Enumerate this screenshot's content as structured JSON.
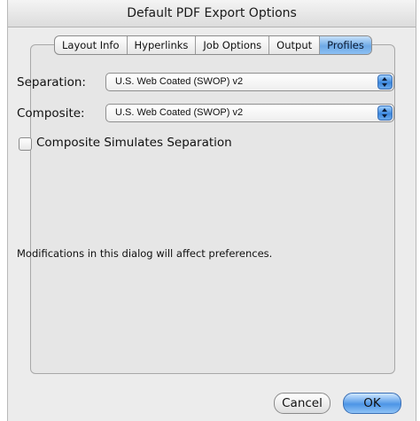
{
  "window": {
    "title": "Default PDF Export Options"
  },
  "tabs": [
    {
      "label": "Layout Info",
      "selected": false
    },
    {
      "label": "Hyperlinks",
      "selected": false
    },
    {
      "label": "Job Options",
      "selected": false
    },
    {
      "label": "Output",
      "selected": false
    },
    {
      "label": "Profiles",
      "selected": true
    }
  ],
  "fields": {
    "separation": {
      "label": "Separation:",
      "value": "U.S. Web Coated (SWOP) v2"
    },
    "composite": {
      "label": "Composite:",
      "value": "U.S. Web Coated (SWOP) v2"
    }
  },
  "checkbox": {
    "label": "Composite Simulates Separation",
    "checked": false
  },
  "note": "Modifications in this dialog will affect preferences.",
  "buttons": {
    "cancel": "Cancel",
    "ok": "OK"
  },
  "colors": {
    "accent": "#4d95e6",
    "window_bg": "#ececec"
  }
}
